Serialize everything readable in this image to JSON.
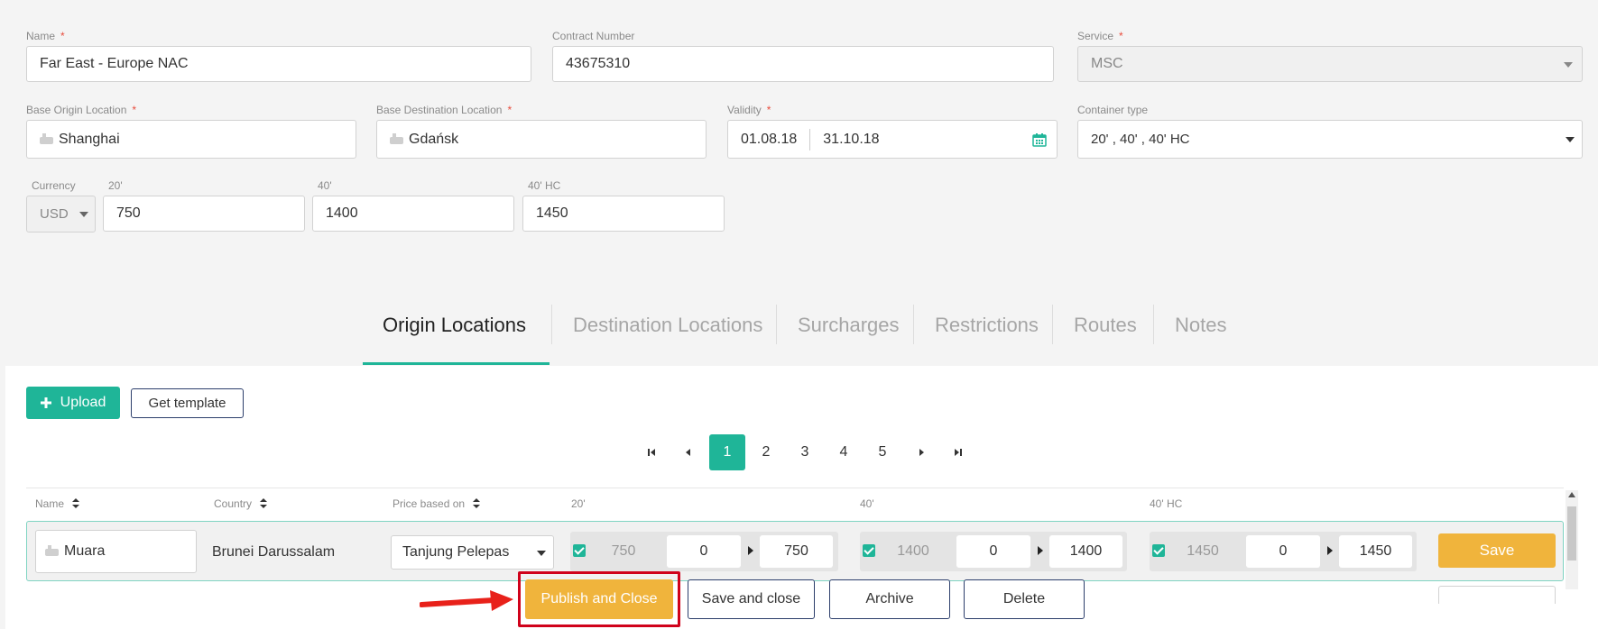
{
  "form": {
    "name": {
      "label": "Name",
      "required": "*",
      "value": "Far East - Europe NAC"
    },
    "contract_number": {
      "label": "Contract Number",
      "value": "43675310"
    },
    "service": {
      "label": "Service",
      "required": "*",
      "value": "MSC"
    },
    "base_origin": {
      "label": "Base Origin Location",
      "required": "*",
      "value": "Shanghai"
    },
    "base_destination": {
      "label": "Base Destination Location",
      "required": "*",
      "value": "Gdańsk"
    },
    "validity": {
      "label": "Validity",
      "required": "*",
      "from": "01.08.18",
      "to": "31.10.18"
    },
    "container_type": {
      "label": "Container type",
      "value": "20' , 40' , 40' HC"
    },
    "currency": {
      "label": "Currency",
      "value": "USD"
    },
    "price_20": {
      "label": "20'",
      "value": "750"
    },
    "price_40": {
      "label": "40'",
      "value": "1400"
    },
    "price_40hc": {
      "label": "40' HC",
      "value": "1450"
    }
  },
  "tabs": [
    {
      "label": "Origin Locations",
      "active": true
    },
    {
      "label": "Destination Locations",
      "active": false
    },
    {
      "label": "Surcharges",
      "active": false
    },
    {
      "label": "Restrictions",
      "active": false
    },
    {
      "label": "Routes",
      "active": false
    },
    {
      "label": "Notes",
      "active": false
    }
  ],
  "toolbar": {
    "upload_label": "Upload",
    "template_label": "Get template"
  },
  "pagination": {
    "pages": [
      "1",
      "2",
      "3",
      "4",
      "5"
    ],
    "current": "1"
  },
  "table": {
    "headers": {
      "name": "Name",
      "country": "Country",
      "price_based_on": "Price based on",
      "c20": "20'",
      "c40": "40'",
      "c40hc": "40' HC"
    },
    "row": {
      "name": "Muara",
      "country": "Brunei Darussalam",
      "price_based_on": "Tanjung Pelepas",
      "c20": {
        "base": "750",
        "adjust": "0",
        "total": "750"
      },
      "c40": {
        "base": "1400",
        "adjust": "0",
        "total": "1400"
      },
      "c40hc": {
        "base": "1450",
        "adjust": "0",
        "total": "1450"
      },
      "save_label": "Save"
    }
  },
  "footer": {
    "publish_label": "Publish and Close",
    "save_close_label": "Save and close",
    "archive_label": "Archive",
    "delete_label": "Delete"
  },
  "colors": {
    "accent": "#1fb598",
    "warning": "#f0b43c",
    "highlight": "#d0021b",
    "outline": "#2c3e6b"
  }
}
